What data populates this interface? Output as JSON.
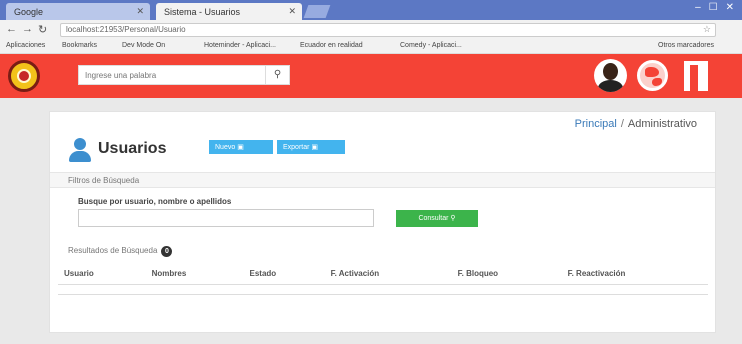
{
  "browser": {
    "tabs": [
      {
        "label": "Google",
        "active": false
      },
      {
        "label": "Sistema - Usuarios",
        "active": true
      }
    ],
    "url": "localhost:21953/Personal/Usuario",
    "bookmarks": [
      "Aplicaciones",
      "Bookmarks",
      "Dev Mode On",
      "Hoteminder - Aplicaci...",
      "Ecuador en realidad",
      "Comedy - Aplicaci...",
      "Otros marcadores"
    ]
  },
  "header": {
    "search_placeholder": "Ingrese una palabra",
    "colors": {
      "bar": "#f44336"
    }
  },
  "breadcrumb": {
    "principal": "Principal",
    "separator": "/",
    "current": "Administrativo"
  },
  "page": {
    "title": "Usuarios",
    "nuevo_label": "Nuevo",
    "exportar_label": "Exportar"
  },
  "filters": {
    "section_title": "Filtros de Búsqueda",
    "search_label": "Busque por usuario, nombre o apellidos",
    "search_value": "",
    "consultar_label": "Consultar"
  },
  "results": {
    "section_title": "Resultados de Búsqueda",
    "count": "0",
    "columns": [
      "Usuario",
      "Nombres",
      "Estado",
      "F. Activación",
      "F. Bloqueo",
      "F. Reactivación"
    ]
  }
}
